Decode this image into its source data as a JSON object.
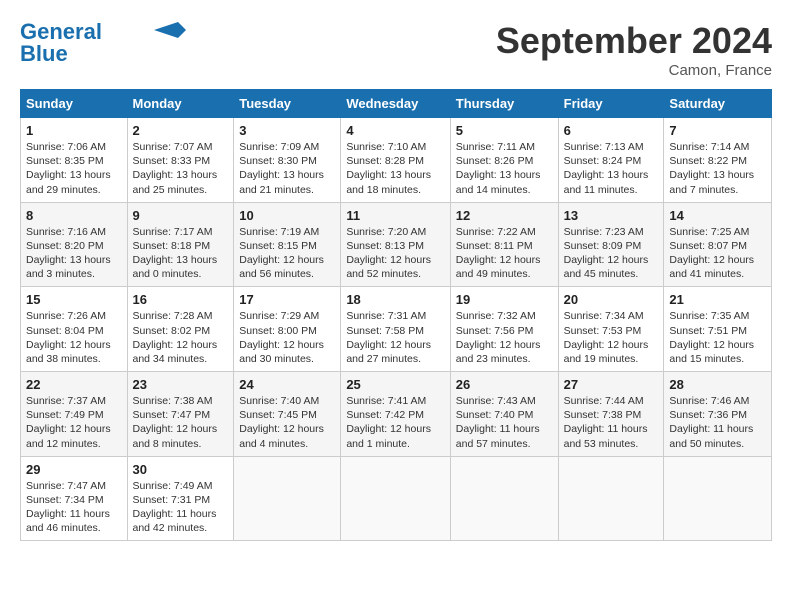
{
  "header": {
    "logo_line1": "General",
    "logo_line2": "Blue",
    "month_title": "September 2024",
    "location": "Camon, France"
  },
  "days_of_week": [
    "Sunday",
    "Monday",
    "Tuesday",
    "Wednesday",
    "Thursday",
    "Friday",
    "Saturday"
  ],
  "weeks": [
    [
      {
        "day": "1",
        "info": "Sunrise: 7:06 AM\nSunset: 8:35 PM\nDaylight: 13 hours\nand 29 minutes."
      },
      {
        "day": "2",
        "info": "Sunrise: 7:07 AM\nSunset: 8:33 PM\nDaylight: 13 hours\nand 25 minutes."
      },
      {
        "day": "3",
        "info": "Sunrise: 7:09 AM\nSunset: 8:30 PM\nDaylight: 13 hours\nand 21 minutes."
      },
      {
        "day": "4",
        "info": "Sunrise: 7:10 AM\nSunset: 8:28 PM\nDaylight: 13 hours\nand 18 minutes."
      },
      {
        "day": "5",
        "info": "Sunrise: 7:11 AM\nSunset: 8:26 PM\nDaylight: 13 hours\nand 14 minutes."
      },
      {
        "day": "6",
        "info": "Sunrise: 7:13 AM\nSunset: 8:24 PM\nDaylight: 13 hours\nand 11 minutes."
      },
      {
        "day": "7",
        "info": "Sunrise: 7:14 AM\nSunset: 8:22 PM\nDaylight: 13 hours\nand 7 minutes."
      }
    ],
    [
      {
        "day": "8",
        "info": "Sunrise: 7:16 AM\nSunset: 8:20 PM\nDaylight: 13 hours\nand 3 minutes."
      },
      {
        "day": "9",
        "info": "Sunrise: 7:17 AM\nSunset: 8:18 PM\nDaylight: 13 hours\nand 0 minutes."
      },
      {
        "day": "10",
        "info": "Sunrise: 7:19 AM\nSunset: 8:15 PM\nDaylight: 12 hours\nand 56 minutes."
      },
      {
        "day": "11",
        "info": "Sunrise: 7:20 AM\nSunset: 8:13 PM\nDaylight: 12 hours\nand 52 minutes."
      },
      {
        "day": "12",
        "info": "Sunrise: 7:22 AM\nSunset: 8:11 PM\nDaylight: 12 hours\nand 49 minutes."
      },
      {
        "day": "13",
        "info": "Sunrise: 7:23 AM\nSunset: 8:09 PM\nDaylight: 12 hours\nand 45 minutes."
      },
      {
        "day": "14",
        "info": "Sunrise: 7:25 AM\nSunset: 8:07 PM\nDaylight: 12 hours\nand 41 minutes."
      }
    ],
    [
      {
        "day": "15",
        "info": "Sunrise: 7:26 AM\nSunset: 8:04 PM\nDaylight: 12 hours\nand 38 minutes."
      },
      {
        "day": "16",
        "info": "Sunrise: 7:28 AM\nSunset: 8:02 PM\nDaylight: 12 hours\nand 34 minutes."
      },
      {
        "day": "17",
        "info": "Sunrise: 7:29 AM\nSunset: 8:00 PM\nDaylight: 12 hours\nand 30 minutes."
      },
      {
        "day": "18",
        "info": "Sunrise: 7:31 AM\nSunset: 7:58 PM\nDaylight: 12 hours\nand 27 minutes."
      },
      {
        "day": "19",
        "info": "Sunrise: 7:32 AM\nSunset: 7:56 PM\nDaylight: 12 hours\nand 23 minutes."
      },
      {
        "day": "20",
        "info": "Sunrise: 7:34 AM\nSunset: 7:53 PM\nDaylight: 12 hours\nand 19 minutes."
      },
      {
        "day": "21",
        "info": "Sunrise: 7:35 AM\nSunset: 7:51 PM\nDaylight: 12 hours\nand 15 minutes."
      }
    ],
    [
      {
        "day": "22",
        "info": "Sunrise: 7:37 AM\nSunset: 7:49 PM\nDaylight: 12 hours\nand 12 minutes."
      },
      {
        "day": "23",
        "info": "Sunrise: 7:38 AM\nSunset: 7:47 PM\nDaylight: 12 hours\nand 8 minutes."
      },
      {
        "day": "24",
        "info": "Sunrise: 7:40 AM\nSunset: 7:45 PM\nDaylight: 12 hours\nand 4 minutes."
      },
      {
        "day": "25",
        "info": "Sunrise: 7:41 AM\nSunset: 7:42 PM\nDaylight: 12 hours\nand 1 minute."
      },
      {
        "day": "26",
        "info": "Sunrise: 7:43 AM\nSunset: 7:40 PM\nDaylight: 11 hours\nand 57 minutes."
      },
      {
        "day": "27",
        "info": "Sunrise: 7:44 AM\nSunset: 7:38 PM\nDaylight: 11 hours\nand 53 minutes."
      },
      {
        "day": "28",
        "info": "Sunrise: 7:46 AM\nSunset: 7:36 PM\nDaylight: 11 hours\nand 50 minutes."
      }
    ],
    [
      {
        "day": "29",
        "info": "Sunrise: 7:47 AM\nSunset: 7:34 PM\nDaylight: 11 hours\nand 46 minutes."
      },
      {
        "day": "30",
        "info": "Sunrise: 7:49 AM\nSunset: 7:31 PM\nDaylight: 11 hours\nand 42 minutes."
      },
      {
        "day": "",
        "info": ""
      },
      {
        "day": "",
        "info": ""
      },
      {
        "day": "",
        "info": ""
      },
      {
        "day": "",
        "info": ""
      },
      {
        "day": "",
        "info": ""
      }
    ]
  ]
}
